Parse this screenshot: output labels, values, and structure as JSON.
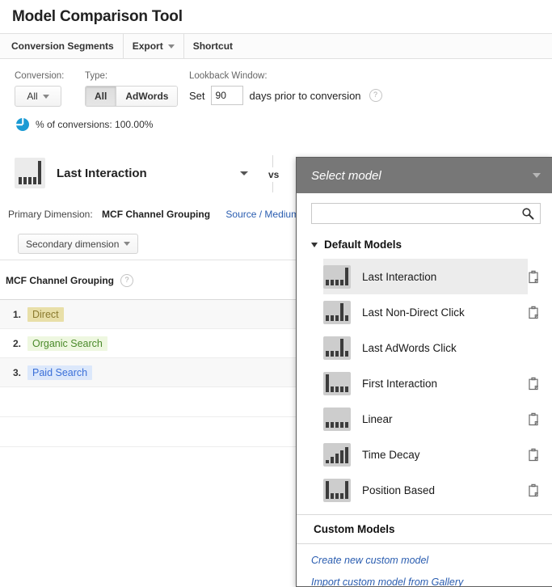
{
  "page": {
    "title": "Model Comparison Tool"
  },
  "toolbar": {
    "items": [
      {
        "label": "Conversion Segments",
        "has_caret": false
      },
      {
        "label": "Export",
        "has_caret": true
      },
      {
        "label": "Shortcut",
        "has_caret": false
      }
    ]
  },
  "controls": {
    "conversion": {
      "label": "Conversion:",
      "value": "All"
    },
    "type": {
      "label": "Type:",
      "options": [
        "All",
        "AdWords"
      ],
      "selected": "All"
    },
    "lookback": {
      "label": "Lookback Window:",
      "prefix": "Set",
      "days": "90",
      "suffix": "days prior to conversion",
      "help": "?"
    },
    "conversions_stat": "% of conversions: 100.00%"
  },
  "model_row": {
    "selected_model": "Last Interaction",
    "vs": "vs",
    "icon_bars": [
      30,
      30,
      30,
      30,
      100
    ]
  },
  "primary_dimension": {
    "label": "Primary Dimension:",
    "active": "MCF Channel Grouping",
    "links": [
      "Source / Medium",
      "Sour"
    ]
  },
  "secondary_dimension": {
    "label": "Secondary dimension"
  },
  "table": {
    "header": "MCF Channel Grouping",
    "header_help": "?",
    "rows": [
      {
        "rank": "1.",
        "label": "Direct",
        "bg": "#e8dfa8",
        "fg": "#8a7a2e"
      },
      {
        "rank": "2.",
        "label": "Organic Search",
        "bg": "#eef7e0",
        "fg": "#4a8a2a"
      },
      {
        "rank": "3.",
        "label": "Paid Search",
        "bg": "#dce8fb",
        "fg": "#3a6fd8"
      }
    ]
  },
  "model_panel": {
    "header_title": "Select model",
    "search_value": "",
    "search_placeholder": "",
    "default_group_title": "Default Models",
    "models": [
      {
        "label": "Last Interaction",
        "selected": true,
        "has_copy": true,
        "bars": [
          30,
          30,
          30,
          30,
          100
        ]
      },
      {
        "label": "Last Non-Direct Click",
        "selected": false,
        "has_copy": true,
        "bars": [
          30,
          30,
          30,
          100,
          30
        ]
      },
      {
        "label": "Last AdWords Click",
        "selected": false,
        "has_copy": false,
        "bars": [
          30,
          30,
          30,
          100,
          30
        ]
      },
      {
        "label": "First Interaction",
        "selected": false,
        "has_copy": true,
        "bars": [
          100,
          30,
          30,
          30,
          30
        ]
      },
      {
        "label": "Linear",
        "selected": false,
        "has_copy": true,
        "bars": [
          30,
          30,
          30,
          30,
          30
        ]
      },
      {
        "label": "Time Decay",
        "selected": false,
        "has_copy": true,
        "bars": [
          18,
          35,
          52,
          70,
          88
        ]
      },
      {
        "label": "Position Based",
        "selected": false,
        "has_copy": true,
        "bars": [
          100,
          30,
          30,
          30,
          100
        ]
      }
    ],
    "custom_group_title": "Custom Models",
    "custom_links": [
      "Create new custom model",
      "Import custom model from Gallery"
    ]
  },
  "colors": {
    "panel_header_bg": "#777777",
    "link": "#2a5db0",
    "accent_blue": "#1a9ad4",
    "bar_dark": "#3c3c3c",
    "icon_bg_small": "#cdcdcd",
    "icon_bg_big": "#ebebeb"
  }
}
